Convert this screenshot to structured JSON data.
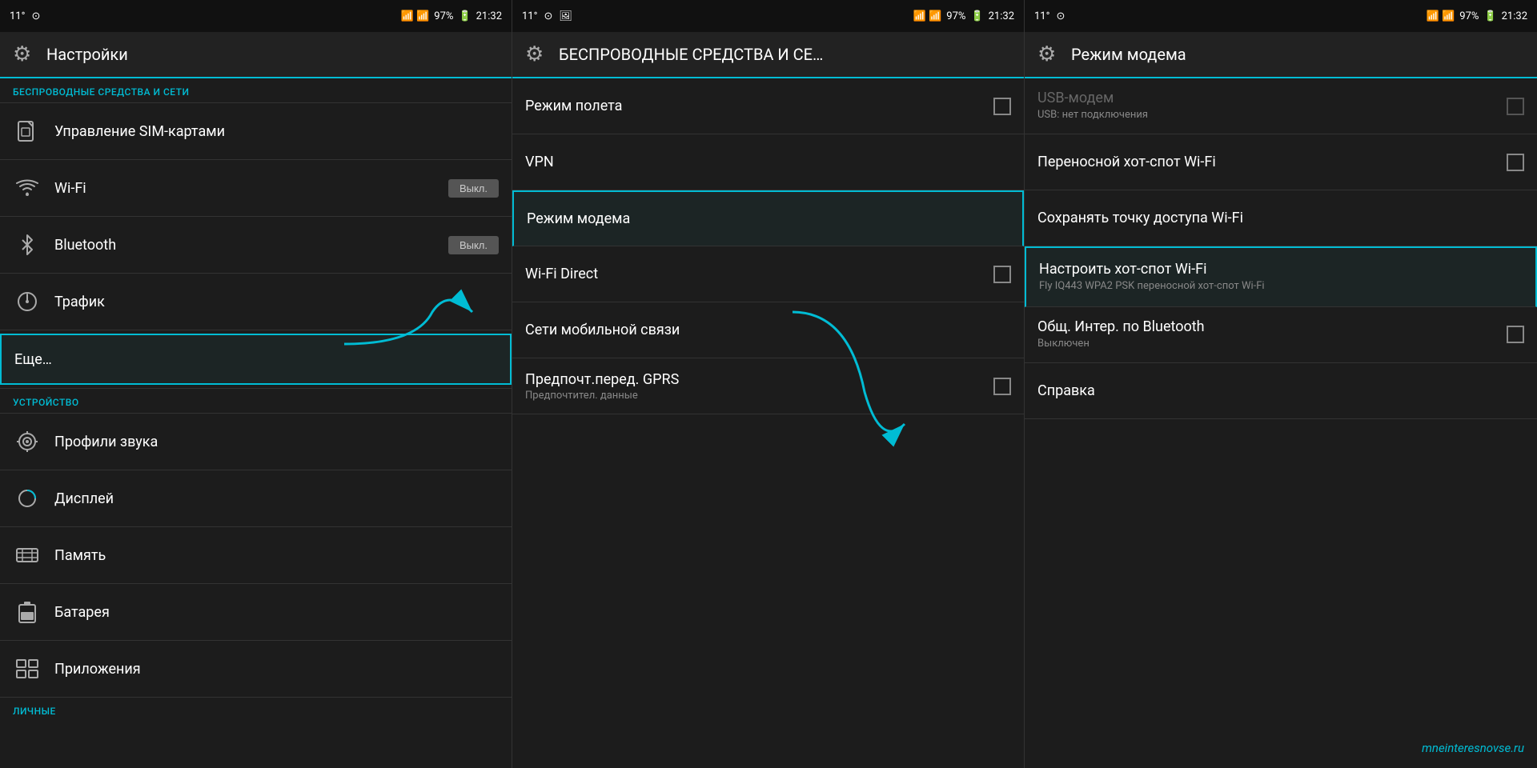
{
  "status": {
    "left_temp": "11°",
    "left_icons": "⊙",
    "signal": "📶",
    "battery": "97%",
    "time": "21:32"
  },
  "panel1": {
    "title": "Настройки",
    "section1": "БЕСПРОВОДНЫЕ СРЕДСТВА И СЕТИ",
    "items": [
      {
        "id": "sim",
        "icon": "sim",
        "label": "Управление SIM-картами",
        "toggle": null
      },
      {
        "id": "wifi",
        "icon": "wifi",
        "label": "Wi-Fi",
        "toggle": "Выкл."
      },
      {
        "id": "bluetooth",
        "icon": "bt",
        "label": "Bluetooth",
        "toggle": "Выкл."
      },
      {
        "id": "traffic",
        "icon": "traffic",
        "label": "Трафик",
        "toggle": null
      },
      {
        "id": "more",
        "icon": null,
        "label": "Еще…",
        "toggle": null,
        "boxed": true
      }
    ],
    "section2": "УСТРОЙСТВО",
    "device_items": [
      {
        "id": "sound",
        "icon": "sound",
        "label": "Профили звука"
      },
      {
        "id": "display",
        "icon": "display",
        "label": "Дисплей"
      },
      {
        "id": "memory",
        "icon": "memory",
        "label": "Память"
      },
      {
        "id": "battery",
        "icon": "battery",
        "label": "Батарея"
      },
      {
        "id": "apps",
        "icon": "apps",
        "label": "Приложения"
      }
    ],
    "section3": "ЛИЧНЫЕ"
  },
  "panel2": {
    "title": "БЕСПРОВОДНЫЕ СРЕДСТВА И СЕ…",
    "items": [
      {
        "id": "airplane",
        "label": "Режим полета",
        "sublabel": null,
        "has_cb": true,
        "boxed": false
      },
      {
        "id": "vpn",
        "label": "VPN",
        "sublabel": null,
        "has_cb": false,
        "boxed": false
      },
      {
        "id": "modem",
        "label": "Режим модема",
        "sublabel": null,
        "has_cb": false,
        "boxed": true
      },
      {
        "id": "wifidirect",
        "label": "Wi-Fi Direct",
        "sublabel": null,
        "has_cb": true,
        "boxed": false
      },
      {
        "id": "mobile",
        "label": "Сети мобильной связи",
        "sublabel": null,
        "has_cb": false,
        "boxed": false
      },
      {
        "id": "gprs",
        "label": "Предпочт.перед. GPRS",
        "sublabel": "Предпочтител. данные",
        "has_cb": true,
        "boxed": false
      }
    ]
  },
  "panel3": {
    "title": "Режим модема",
    "items": [
      {
        "id": "usb",
        "title": "USB-модем",
        "sub": "USB: нет подключения",
        "has_cb": true,
        "disabled": true,
        "boxed": false
      },
      {
        "id": "hotspot",
        "title": "Переносной хот-спот Wi-Fi",
        "sub": null,
        "has_cb": true,
        "disabled": false,
        "boxed": false
      },
      {
        "id": "saveap",
        "title": "Сохранять точку доступа Wi-Fi",
        "sub": null,
        "has_cb": false,
        "disabled": false,
        "boxed": false
      },
      {
        "id": "configap",
        "title": "Настроить хот-спот Wi-Fi",
        "sub": "Fly IQ443 WPA2 PSK переносной хот-спот Wi-Fi",
        "has_cb": false,
        "disabled": false,
        "boxed": true
      },
      {
        "id": "bluetooth_sharing",
        "title": "Общ. Интер. по Bluetooth",
        "sub": "Выключен",
        "has_cb": true,
        "disabled": false,
        "boxed": false
      },
      {
        "id": "help",
        "title": "Справка",
        "sub": null,
        "has_cb": false,
        "disabled": false,
        "boxed": false
      }
    ],
    "watermark": "mneinteresnovse.ru"
  },
  "arrows": {
    "arrow1": {
      "from_label": "Еще…",
      "to_label": "Режим модема"
    },
    "arrow2": {
      "from_label": "Режим модема",
      "to_label": "Настроить хот-спот"
    }
  }
}
